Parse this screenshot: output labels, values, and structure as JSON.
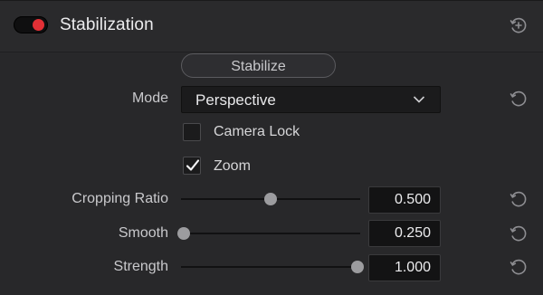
{
  "header": {
    "title": "Stabilization",
    "toggle_on": true,
    "toggle_color": "#e33036",
    "header_icon": "add-keyframe-icon"
  },
  "stabilize_button": {
    "label": "Stabilize"
  },
  "mode": {
    "label": "Mode",
    "value": "Perspective",
    "reset_icon": "reset-icon"
  },
  "camera_lock": {
    "label": "Camera Lock",
    "checked": false
  },
  "zoom": {
    "label": "Zoom",
    "checked": true
  },
  "sliders": [
    {
      "key": "cropping_ratio",
      "label": "Cropping Ratio",
      "value": "0.500",
      "level": 0.5
    },
    {
      "key": "smooth",
      "label": "Smooth",
      "value": "0.250",
      "level": 0.0
    },
    {
      "key": "strength",
      "label": "Strength",
      "value": "1.000",
      "level": 1.0
    }
  ]
}
